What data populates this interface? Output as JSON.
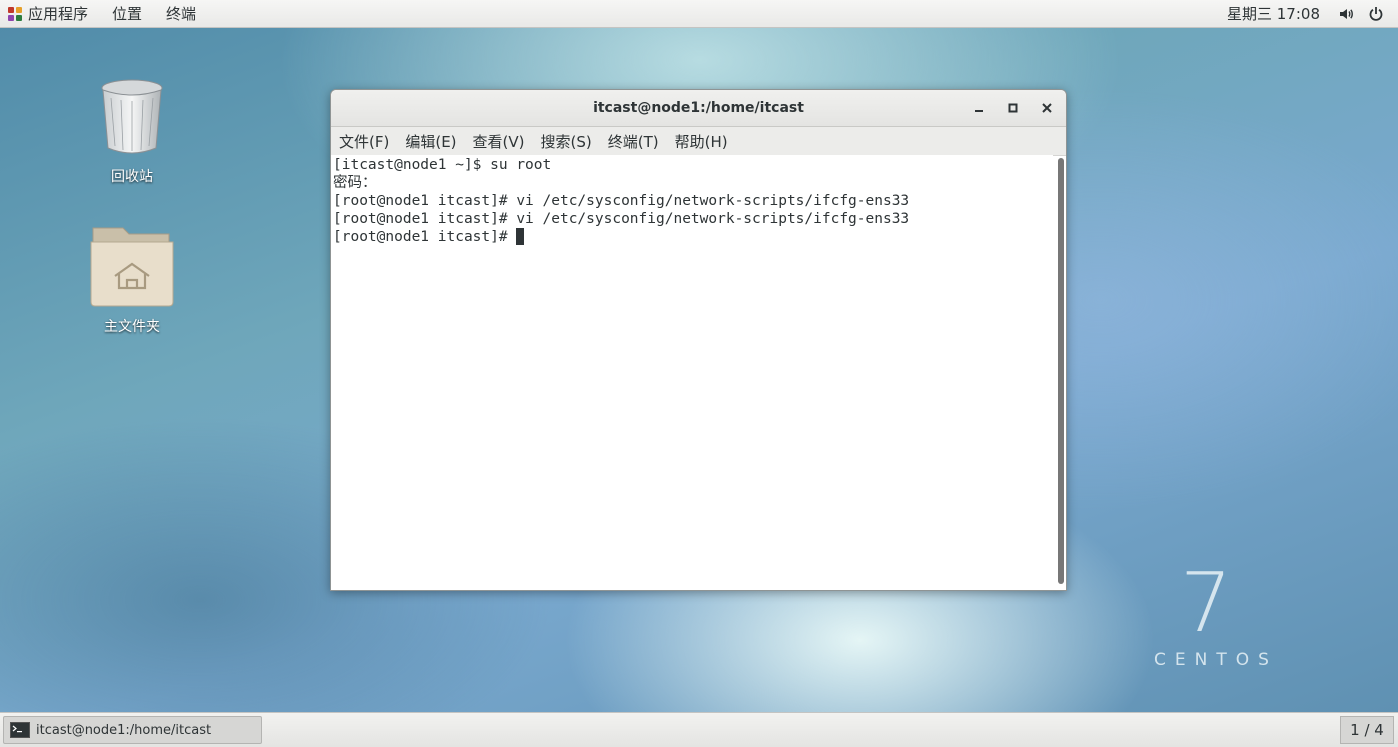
{
  "topbar": {
    "menus": [
      "应用程序",
      "位置",
      "终端"
    ],
    "clock": "星期三 17:08",
    "icons": [
      "volume-icon",
      "power-icon"
    ]
  },
  "desktop": {
    "icons": [
      {
        "label": "回收站",
        "icon": "trash-icon"
      },
      {
        "label": "主文件夹",
        "icon": "home-folder-icon"
      }
    ],
    "watermark": {
      "number": "7",
      "text": "CENTOS"
    }
  },
  "window": {
    "title": "itcast@node1:/home/itcast",
    "menu": [
      "文件(F)",
      "编辑(E)",
      "查看(V)",
      "搜索(S)",
      "终端(T)",
      "帮助(H)"
    ],
    "terminal_lines": [
      "[itcast@node1 ~]$ su root",
      "密码：",
      "[root@node1 itcast]# vi /etc/sysconfig/network-scripts/ifcfg-ens33",
      "[root@node1 itcast]# vi /etc/sysconfig/network-scripts/ifcfg-ens33",
      "[root@node1 itcast]# "
    ]
  },
  "taskbar": {
    "task_label": "itcast@node1:/home/itcast",
    "workspace": "1 / 4"
  }
}
